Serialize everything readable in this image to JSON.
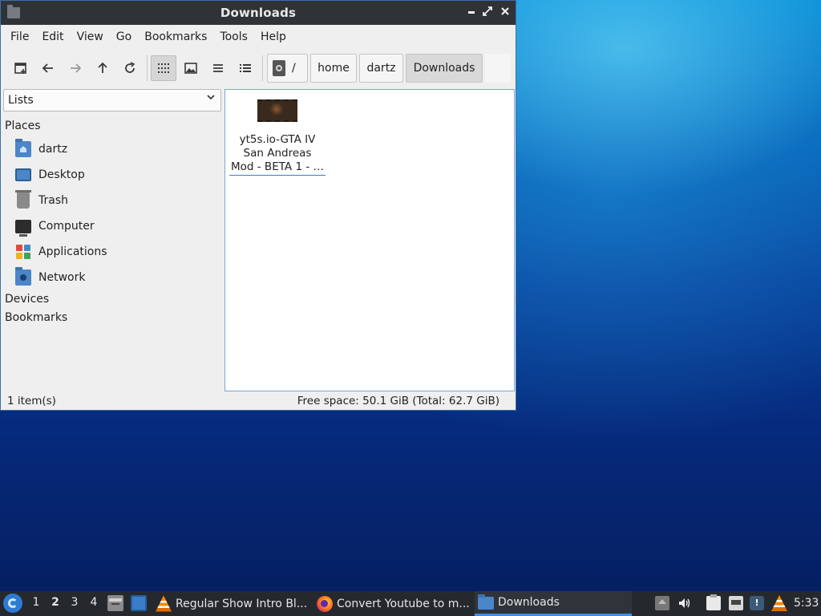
{
  "window": {
    "title": "Downloads",
    "controls": {
      "minimize": "▪",
      "maximize": "⤢",
      "close": "✕"
    }
  },
  "menubar": [
    "File",
    "Edit",
    "View",
    "Go",
    "Bookmarks",
    "Tools",
    "Help"
  ],
  "toolbar": {
    "icons": [
      "new-tab-icon",
      "back-icon",
      "forward-icon",
      "up-icon",
      "reload-icon",
      "icon-view-icon",
      "thumbnail-view-icon",
      "compact-view-icon",
      "detailed-list-icon"
    ],
    "active_view": "icon-view"
  },
  "path": {
    "root": "/",
    "segments": [
      "home",
      "dartz",
      "Downloads"
    ],
    "current": "Downloads"
  },
  "sidebar": {
    "mode": "Lists",
    "sections": {
      "places": "Places",
      "devices": "Devices",
      "bookmarks": "Bookmarks"
    },
    "places": [
      "dartz",
      "Desktop",
      "Trash",
      "Computer",
      "Applications",
      "Network"
    ]
  },
  "files": [
    {
      "name_lines": [
        "yt5s.io-GTA IV",
        "San Andreas",
        "Mod - BETA 1 - …"
      ],
      "type": "video"
    }
  ],
  "status": {
    "count": "1 item(s)",
    "free_space": "Free space: 50.1 GiB (Total: 62.7 GiB)"
  },
  "taskbar": {
    "workspaces": [
      "1",
      "2",
      "3",
      "4"
    ],
    "active_workspace": "2",
    "tasks": [
      {
        "label": "Regular Show Intro Bl...",
        "icon": "vlc-icon"
      },
      {
        "label": "Convert Youtube to m...",
        "icon": "firefox-icon"
      },
      {
        "label": "Downloads",
        "icon": "folder-icon",
        "active": true
      }
    ],
    "tray": {
      "notification_badge": "!"
    },
    "clock": "5:33"
  },
  "colors": {
    "titlebar": "#2f3237",
    "selection": "#3a7cc7",
    "taskbar": "#25292e",
    "desktop": "#063f9a"
  }
}
